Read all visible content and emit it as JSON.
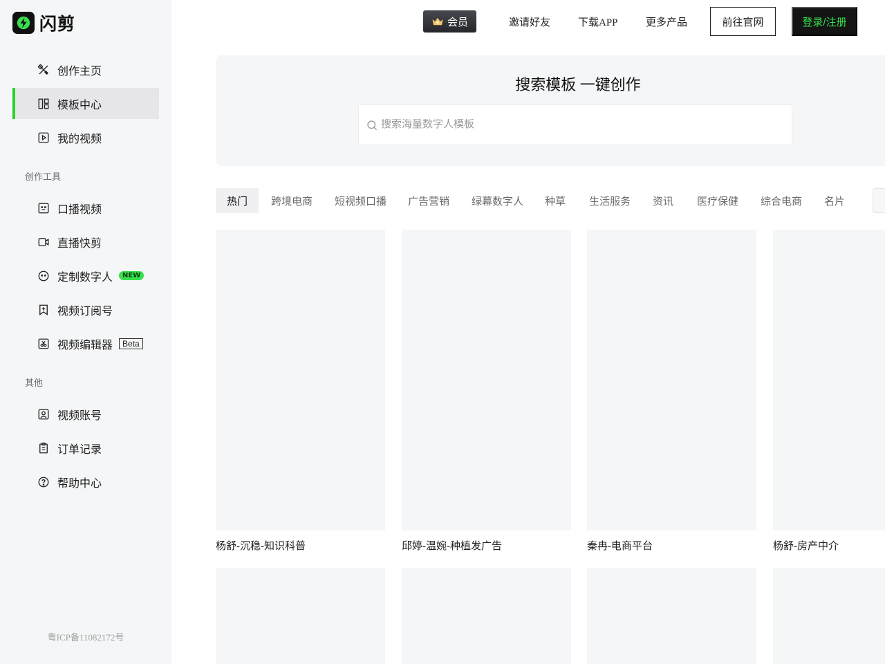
{
  "brand": {
    "name": "闪剪",
    "icon": "lightning-logo-icon",
    "accent": "#37e04c"
  },
  "sidebar": {
    "main_items": [
      {
        "label": "创作主页",
        "icon": "tools-icon",
        "active": false
      },
      {
        "label": "模板中心",
        "icon": "template-icon",
        "active": true
      },
      {
        "label": "我的视频",
        "icon": "play-icon",
        "active": false
      }
    ],
    "tools_section_label": "创作工具",
    "tool_items": [
      {
        "label": "口播视频",
        "icon": "face-scan-icon"
      },
      {
        "label": "直播快剪",
        "icon": "camera-icon"
      },
      {
        "label": "定制数字人",
        "icon": "smile-icon",
        "badge": "NEW"
      },
      {
        "label": "视频订阅号",
        "icon": "bookmark-plus-icon"
      },
      {
        "label": "视频编辑器",
        "icon": "scissors-icon",
        "badge": "Beta"
      }
    ],
    "other_section_label": "其他",
    "other_items": [
      {
        "label": "视频账号",
        "icon": "user-card-icon"
      },
      {
        "label": "订单记录",
        "icon": "clipboard-icon"
      },
      {
        "label": "帮助中心",
        "icon": "help-icon"
      }
    ],
    "icp": "粤ICP备11082172号"
  },
  "header": {
    "vip_label": "会员",
    "links": [
      "邀请好友",
      "下载APP",
      "更多产品"
    ],
    "official_site_label": "前往官网",
    "login_label": "登录/注册"
  },
  "search": {
    "title": "搜索模板 一键创作",
    "placeholder": "搜索海量数字人模板",
    "value": ""
  },
  "tabs": [
    "热门",
    "跨境电商",
    "短视频口播",
    "广告营销",
    "绿幕数字人",
    "种草",
    "生活服务",
    "资讯",
    "医疗保健",
    "综合电商",
    "名片"
  ],
  "active_tab": "热门",
  "templates": [
    "杨舒-沉稳-知识科普",
    "邱婷-温婉-种植发广告",
    "秦冉-电商平台",
    "杨舒-房产中介"
  ]
}
